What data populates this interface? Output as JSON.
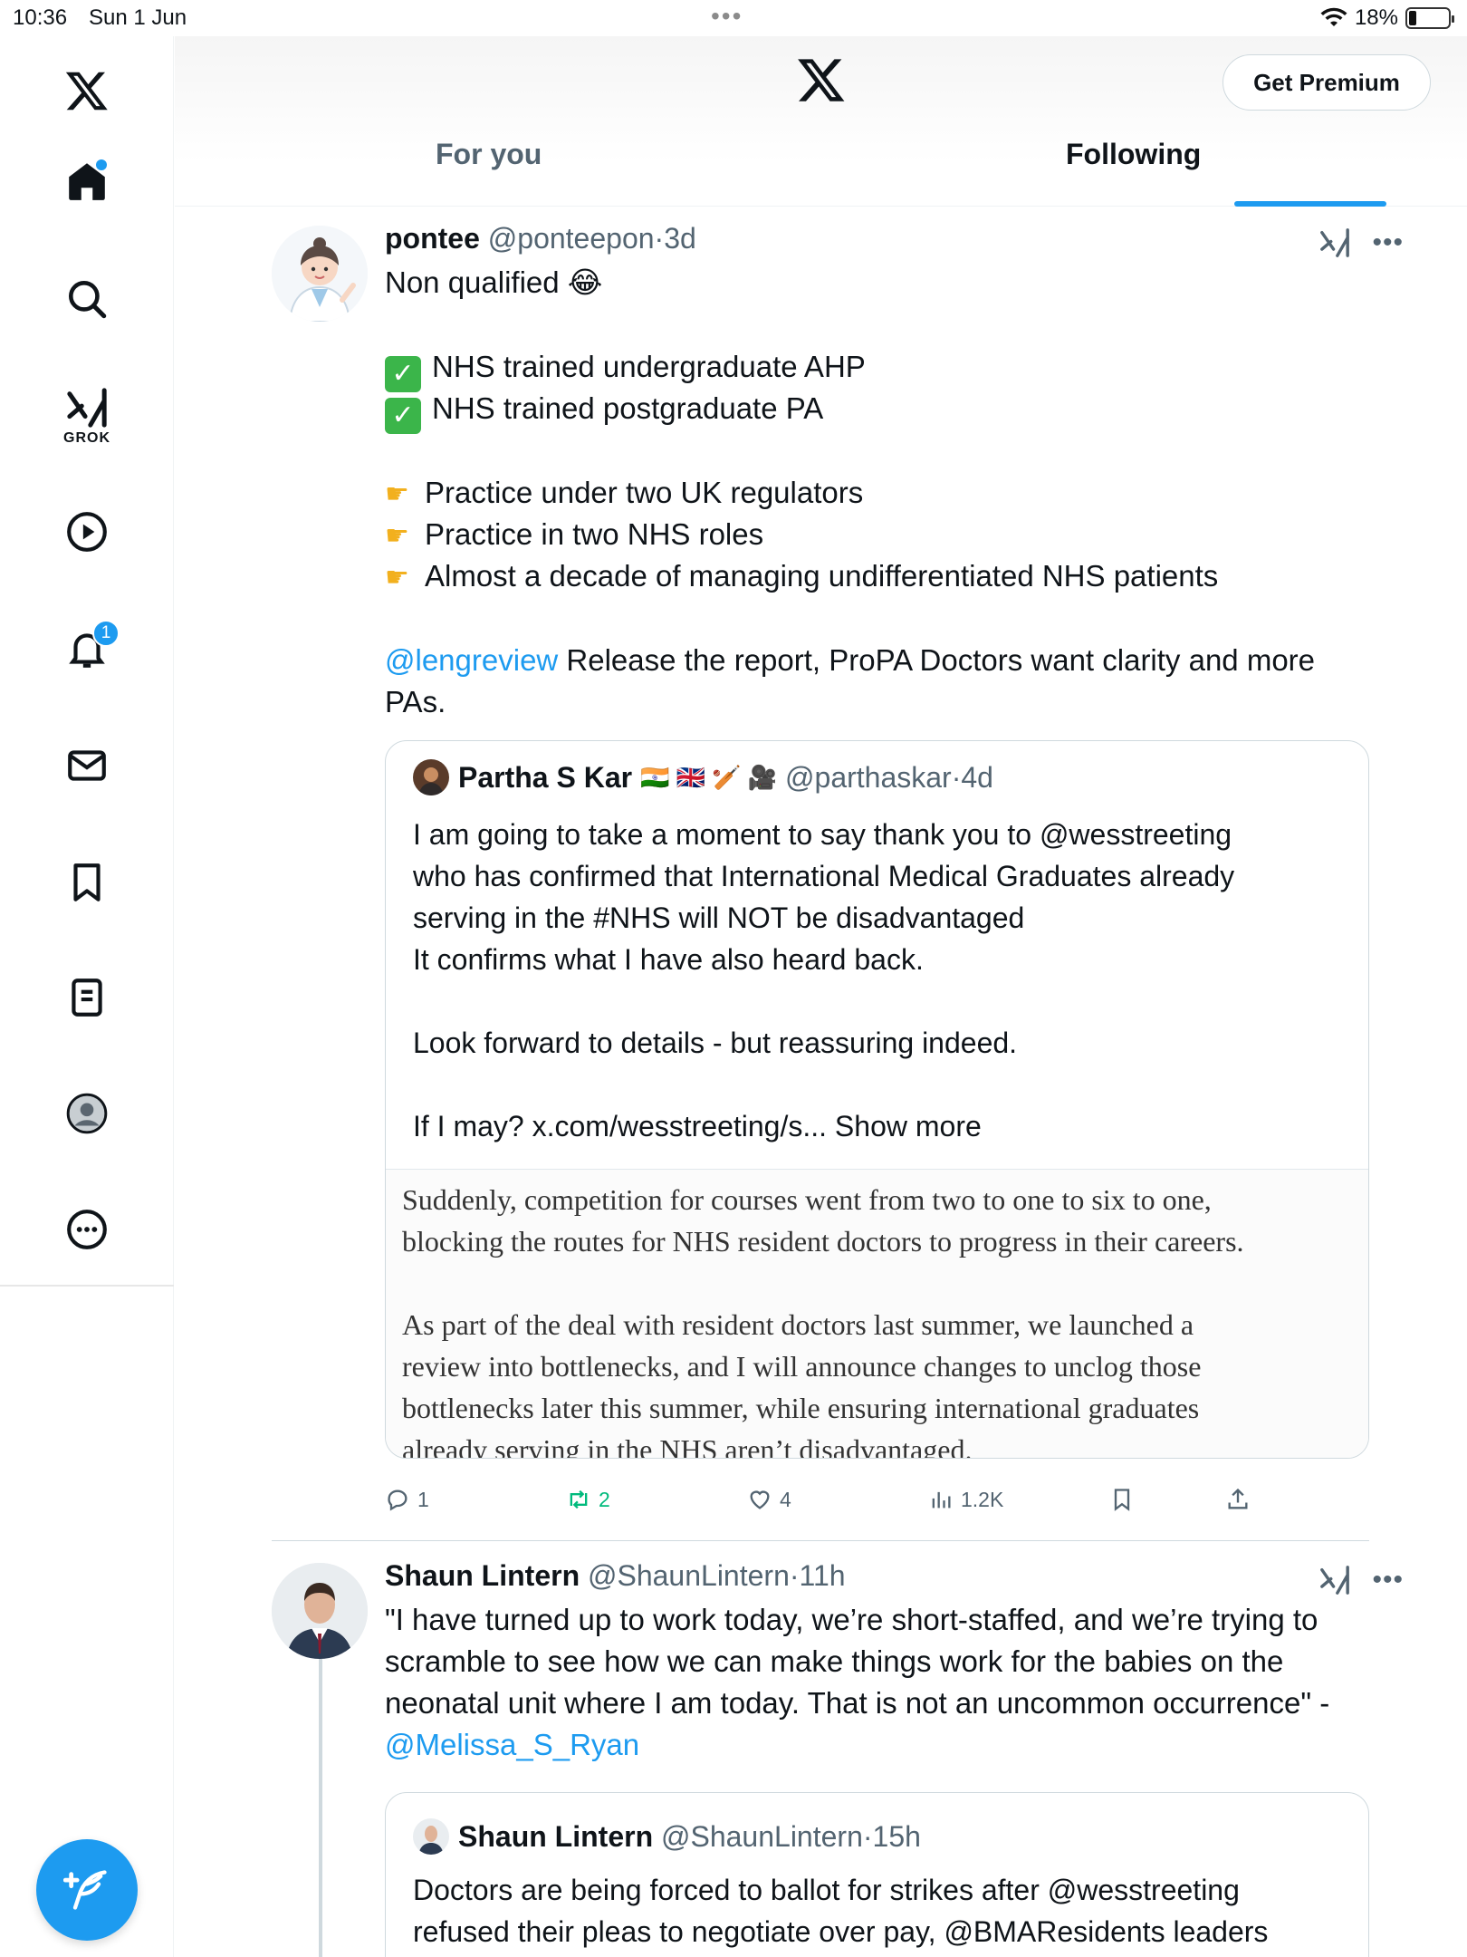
{
  "status_bar": {
    "time": "10:36",
    "date": "Sun 1 Jun",
    "battery": "18%",
    "battery_level": 0.18
  },
  "sidebar": {
    "items": [
      {
        "name": "home",
        "icon": "home-icon"
      },
      {
        "name": "search",
        "icon": "search-icon"
      },
      {
        "name": "grok",
        "icon": "grok-icon",
        "label": "GROK"
      },
      {
        "name": "video",
        "icon": "play-icon"
      },
      {
        "name": "notifications",
        "icon": "bell-icon",
        "badge": "1"
      },
      {
        "name": "messages",
        "icon": "mail-icon"
      },
      {
        "name": "bookmarks",
        "icon": "bookmark-icon"
      },
      {
        "name": "lists",
        "icon": "list-icon"
      },
      {
        "name": "profile",
        "icon": "avatar-icon"
      },
      {
        "name": "more",
        "icon": "more-icon"
      }
    ]
  },
  "header": {
    "get_premium": "Get Premium",
    "tabs": [
      {
        "label": "For you"
      },
      {
        "label": "Following",
        "active": true
      }
    ]
  },
  "tweets": [
    {
      "name": "pontee",
      "handle": "@ponteepon",
      "time": "3d",
      "lines": {
        "l1": "Non qualified 😂",
        "l2": "NHS trained undergraduate AHP",
        "l3": "NHS trained postgraduate PA",
        "l4": "Practice under two UK regulators",
        "l5": "Practice in two NHS roles",
        "l6": "Almost a decade of managing undifferentiated NHS patients",
        "mention": "@lengreview",
        "l7": " Release the report, ProPA Doctors want clarity and more",
        "l8": "PAs."
      },
      "quote": {
        "name": "Partha S Kar",
        "flags": "🇮🇳 🇬🇧 🏏 🎥",
        "handle": "@parthaskar",
        "time": "4d",
        "text": "I am going to take a moment to say thank you to @wesstreeting\nwho has confirmed that International Medical Graduates already\nserving in the #NHS will NOT be disadvantaged\nIt confirms what I have also heard back.\n\nLook forward to details - but reassuring indeed.\n\nIf I may? x.com/wesstreeting/s... ",
        "show_more": "Show more",
        "image_text": "Suddenly, competition for courses went from two to one to six to one,\nblocking the routes for NHS resident doctors to progress in their careers.\n\nAs part of the deal with resident doctors last summer, we launched a\nreview into bottlenecks, and I will announce changes to unclog those\nbottlenecks later this summer, while ensuring international graduates\nalready serving in the NHS aren’t disadvantaged."
      },
      "stats": {
        "replies": "1",
        "reposts": "2",
        "likes": "4",
        "views": "1.2K"
      }
    },
    {
      "name": "Shaun Lintern",
      "handle": "@ShaunLintern",
      "time": "11h",
      "text": "\"I have turned up to work today, we’re short-staffed, and we’re trying to\nscramble to see how we can make things work for the babies on the\nneonatal unit where I am today. That is not an uncommon occurrence\" -",
      "mention": "@Melissa_S_Ryan",
      "quote": {
        "name": "Shaun Lintern",
        "handle": "@ShaunLintern",
        "time": "15h",
        "text": "Doctors are being forced to ballot for strikes after @wesstreeting\nrefused their pleas to negotiate over pay, @BMAResidents leaders"
      }
    }
  ],
  "colors": {
    "accent": "#1d9bf0",
    "text": "#0f1419",
    "muted": "#536471",
    "repost": "#00ba7c"
  }
}
